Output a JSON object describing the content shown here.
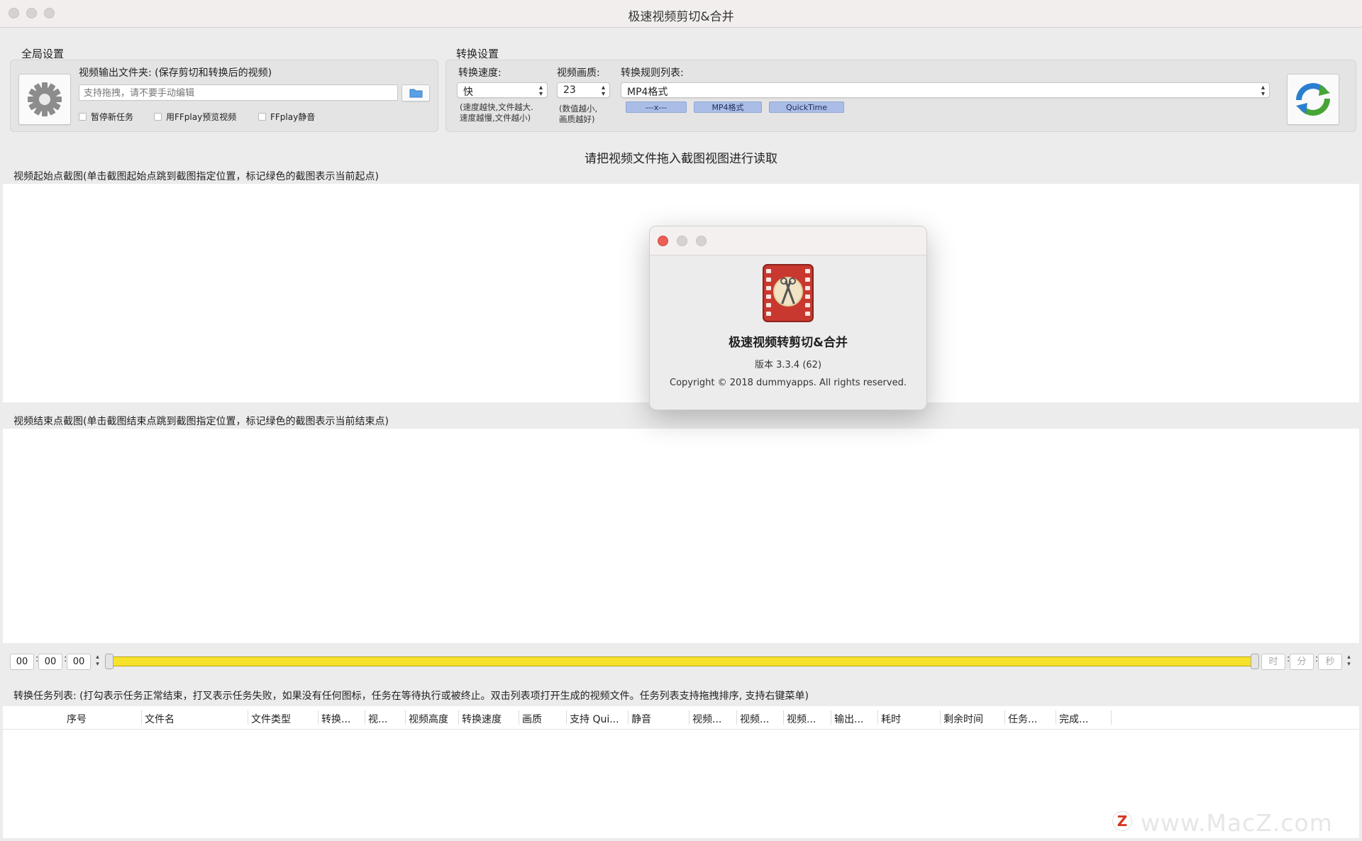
{
  "window": {
    "title": "极速视频剪切&合并"
  },
  "global_settings": {
    "title": "全局设置",
    "output_folder_label": "视频输出文件夹: (保存剪切和转换后的视频)",
    "output_folder_placeholder": "支持拖拽，请不要手动编辑",
    "checkboxes": [
      {
        "label": "暂停新任务",
        "checked": false
      },
      {
        "label": "用FFplay预览视频",
        "checked": false
      },
      {
        "label": "FFplay静音",
        "checked": false
      }
    ]
  },
  "convert_settings": {
    "title": "转换设置",
    "speed_label": "转换速度:",
    "speed_value": "快",
    "speed_hint_1": "(速度越快,文件越大.",
    "speed_hint_2": "速度越慢,文件越小)",
    "quality_label": "视频画质:",
    "quality_value": "23",
    "quality_hint_1": "(数值越小,",
    "quality_hint_2": "画质越好)",
    "rules_label": "转换规则列表:",
    "rules_value": "MP4格式",
    "rule_chips": [
      "---x---",
      "MP4格式",
      "QuickTime"
    ]
  },
  "main": {
    "drop_hint": "请把视频文件拖入截图视图进行读取",
    "start_label": "视频起始点截图(单击截图起始点跳到截图指定位置，标记绿色的截图表示当前起点)",
    "end_label": "视频结束点截图(单击截图结束点跳到截图指定位置，标记绿色的截图表示当前结束点)"
  },
  "timeline": {
    "start": [
      "00",
      "00",
      "00"
    ],
    "end_placeholders": [
      "时",
      "分",
      "秒"
    ]
  },
  "task_list": {
    "label": "转换任务列表: (打勾表示任务正常结束，打叉表示任务失败，如果没有任何图标，任务在等待执行或被终止。双击列表项打开生成的视频文件。任务列表支持拖拽排序, 支持右键菜单)",
    "columns": [
      "序号",
      "文件名",
      "文件类型",
      "转换...",
      "视...",
      "视频高度",
      "转换速度",
      "画质",
      "支持 Qui...",
      "静音",
      "视频...",
      "视频...",
      "视频...",
      "输出...",
      "耗时",
      "剩余时间",
      "任务...",
      "完成..."
    ]
  },
  "about_dialog": {
    "app_name": "极速视频转剪切&合并",
    "version": "版本 3.3.4 (62)",
    "copyright": "Copyright © 2018 dummyapps. All rights reserved."
  },
  "watermark": {
    "text": "www.MacZ.com",
    "logo_letter": "Z"
  },
  "colors": {
    "slider": "#f6e22a",
    "chip": "#a9bde6",
    "close_red": "#ec5f57",
    "refresh_blue": "#2b7fd1",
    "refresh_green": "#46a534"
  }
}
